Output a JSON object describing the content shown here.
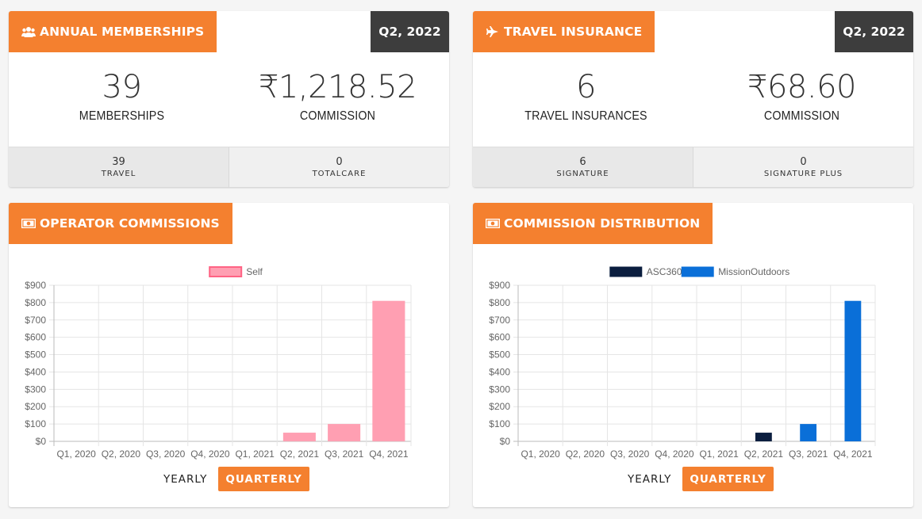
{
  "colors": {
    "accent": "#f4802f",
    "period_bg": "#3d3d3d",
    "self": "#ff9fb2",
    "asc360": "#0b1e3f",
    "missionoutdoors": "#0a6fd8"
  },
  "memberships": {
    "title": "ANNUAL MEMBERSHIPS",
    "icon": "users-icon",
    "period": "Q2, 2022",
    "count_value": "39",
    "count_label": "MEMBERSHIPS",
    "commission_value": "₹1,218.52",
    "commission_label": "COMMISSION",
    "sub": [
      {
        "value": "39",
        "label": "TRAVEL"
      },
      {
        "value": "0",
        "label": "TOTALCARE"
      }
    ]
  },
  "travel": {
    "title": "TRAVEL INSURANCE",
    "icon": "plane-icon",
    "period": "Q2, 2022",
    "count_value": "6",
    "count_label": "TRAVEL INSURANCES",
    "commission_value": "₹68.60",
    "commission_label": "COMMISSION",
    "sub": [
      {
        "value": "6",
        "label": "SIGNATURE"
      },
      {
        "value": "0",
        "label": "SIGNATURE PLUS"
      }
    ]
  },
  "operator": {
    "title": "OPERATOR COMMISSIONS",
    "icon": "money-icon",
    "toggle": {
      "yearly": "YEARLY",
      "quarterly": "QUARTERLY"
    }
  },
  "distribution": {
    "title": "COMMISSION DISTRIBUTION",
    "icon": "money-icon",
    "toggle": {
      "yearly": "YEARLY",
      "quarterly": "QUARTERLY"
    }
  },
  "chart_data": [
    {
      "type": "bar",
      "categories": [
        "Q1, 2020",
        "Q2, 2020",
        "Q3, 2020",
        "Q4, 2020",
        "Q1, 2021",
        "Q2, 2021",
        "Q3, 2021",
        "Q4, 2021"
      ],
      "series": [
        {
          "name": "Self",
          "color": "#ff9fb2",
          "values": [
            0,
            0,
            0,
            0,
            0,
            50,
            100,
            810
          ]
        }
      ],
      "yticks": [
        "$0",
        "$100",
        "$200",
        "$300",
        "$400",
        "$500",
        "$600",
        "$700",
        "$800",
        "$900"
      ],
      "ylim": [
        0,
        900
      ],
      "grid": true,
      "legend": "top"
    },
    {
      "type": "bar",
      "stacked": true,
      "categories": [
        "Q1, 2020",
        "Q2, 2020",
        "Q3, 2020",
        "Q4, 2020",
        "Q1, 2021",
        "Q2, 2021",
        "Q3, 2021",
        "Q4, 2021"
      ],
      "series": [
        {
          "name": "ASC360",
          "color": "#0b1e3f",
          "values": [
            0,
            0,
            0,
            0,
            0,
            50,
            0,
            0
          ]
        },
        {
          "name": "MissionOutdoors",
          "color": "#0a6fd8",
          "values": [
            0,
            0,
            0,
            0,
            0,
            0,
            100,
            810
          ]
        }
      ],
      "yticks": [
        "$0",
        "$100",
        "$200",
        "$300",
        "$400",
        "$500",
        "$600",
        "$700",
        "$800",
        "$900"
      ],
      "ylim": [
        0,
        900
      ],
      "grid": true,
      "legend": "top"
    }
  ]
}
